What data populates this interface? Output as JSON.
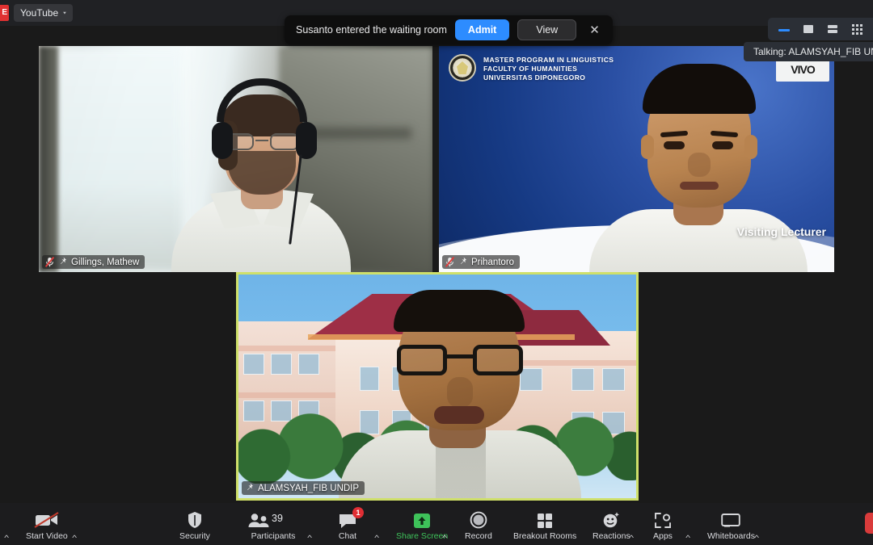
{
  "browser": {
    "bookmark_partial_label": "E",
    "bookmark_folder": "YouTube",
    "caret": "▾"
  },
  "notification": {
    "message": "Susanto entered the waiting room",
    "admit_label": "Admit",
    "view_label": "View",
    "close_label": "✕"
  },
  "view_controls": {
    "minimize_name": "minimize-icon",
    "speaker_name": "speaker-view-icon",
    "sidebyside_name": "side-by-side-view-icon",
    "gallery_name": "gallery-view-icon",
    "talking_label": "Talking: ALAMSYAH_FIB UN"
  },
  "tiles": [
    {
      "id": "gillings",
      "name": "Gillings, Mathew",
      "muted": true,
      "pinned": true,
      "active_speaker": false
    },
    {
      "id": "prihantoro",
      "name": "Prihantoro",
      "muted": true,
      "pinned": true,
      "active_speaker": false,
      "slide": {
        "line1": "MASTER PROGRAM IN LINGUISTICS",
        "line2": "FACULTY OF HUMANITIES",
        "line3": "UNIVERSITAS DIPONEGORO",
        "right_logo": "VIVO",
        "caption": "Visiting Lecturer"
      }
    },
    {
      "id": "alamsyah",
      "name": "ALAMSYAH_FIB UNDIP",
      "muted": false,
      "pinned": true,
      "active_speaker": true
    }
  ],
  "toolbar": {
    "start_video": "Start Video",
    "security": "Security",
    "participants": "Participants",
    "participants_count": "39",
    "chat": "Chat",
    "chat_badge": "1",
    "share_screen": "Share Screen",
    "record": "Record",
    "breakout_rooms": "Breakout Rooms",
    "reactions": "Reactions",
    "apps": "Apps",
    "whiteboards": "Whiteboards",
    "caret": "^"
  },
  "colors": {
    "accent_blue": "#2d8cff",
    "share_green": "#3ec25a",
    "badge_red": "#e02e34",
    "active_speaker_border": "#cfe06a",
    "end_red": "#d93b3b"
  }
}
